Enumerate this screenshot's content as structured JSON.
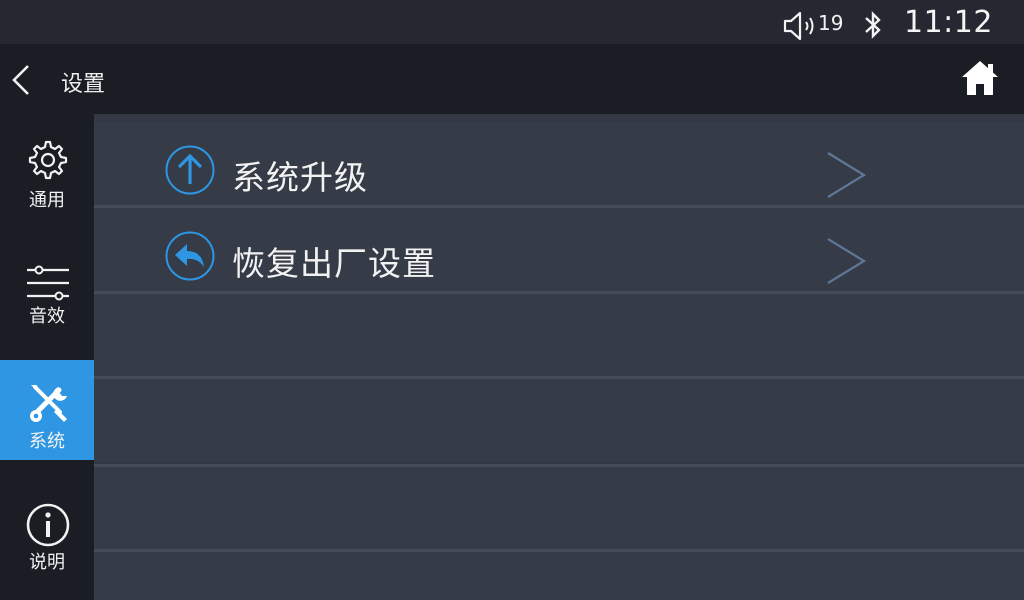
{
  "status_bar": {
    "volume_icon": "speaker-icon",
    "volume_level": "19",
    "bluetooth_icon": "bluetooth-icon",
    "time": "11:12"
  },
  "header": {
    "back_icon": "chevron-left-icon",
    "title": "设置",
    "home_icon": "home-icon"
  },
  "sidebar": {
    "items": [
      {
        "label": "通用",
        "icon": "gear-icon",
        "active": false
      },
      {
        "label": "音效",
        "icon": "sliders-icon",
        "active": false
      },
      {
        "label": "系统",
        "icon": "wrench-screwdriver-icon",
        "active": true
      },
      {
        "label": "说明",
        "icon": "info-icon",
        "active": false
      }
    ]
  },
  "main": {
    "rows": [
      {
        "label": "系统升级",
        "icon": "arrow-up-circle-icon",
        "chevron": "chevron-right-icon"
      },
      {
        "label": "恢复出厂设置",
        "icon": "reply-circle-icon",
        "chevron": "chevron-right-icon"
      }
    ]
  },
  "colors": {
    "accent": "#2e96e2",
    "sidebar_bg": "#1a1d24",
    "list_bg": "#353b47",
    "divider": "#464d5a",
    "chevron": "#5f7796"
  }
}
